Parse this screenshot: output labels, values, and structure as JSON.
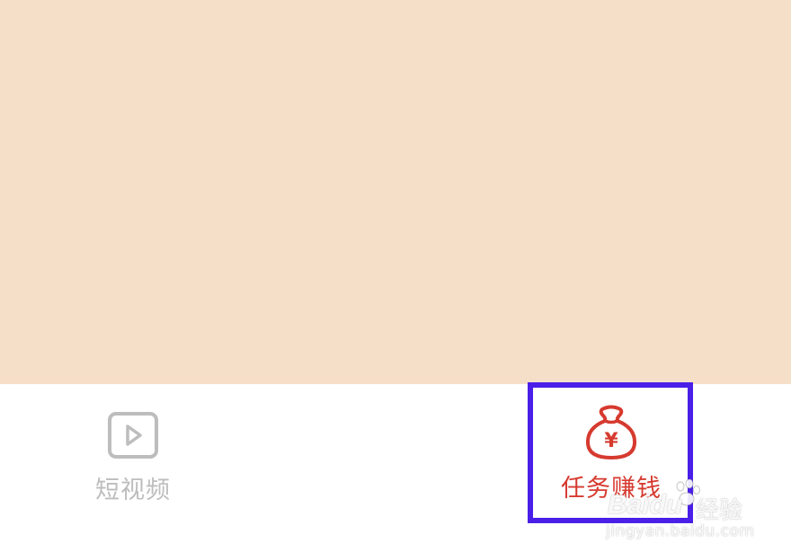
{
  "colors": {
    "content_background": "#F6DFC8",
    "inactive": "#BDBDBD",
    "active": "#D63A2F",
    "highlight": "#4A1FE8"
  },
  "tab_bar": {
    "items": [
      {
        "label": "短视频",
        "icon": "play-video-icon",
        "active": false
      },
      {
        "label": "任务赚钱",
        "icon": "money-bag-icon",
        "icon_glyph": "¥",
        "active": true
      }
    ]
  },
  "watermark": {
    "brand": "Baidu",
    "suffix": "经验",
    "url": "jingyan.baidu.com"
  }
}
